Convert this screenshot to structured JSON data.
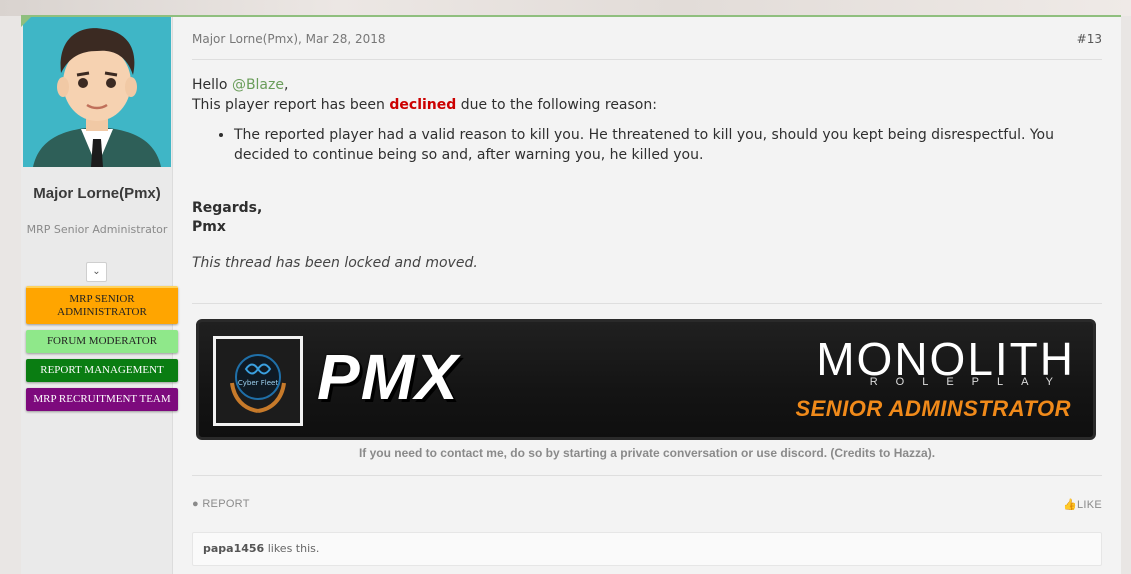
{
  "user": {
    "name": "Major Lorne(Pmx)",
    "title": "MRP Senior Administrator",
    "badges": [
      "MRP SENIOR ADMINISTRATOR",
      "FORUM MODERATOR",
      "REPORT MANAGEMENT",
      "MRP RECRUITMENT TEAM"
    ],
    "badge_colors": [
      "#ffa500",
      "#8fe88a",
      "#0a7d12",
      "#7d0a7d"
    ],
    "toggle_icon": "chevron-down-icon"
  },
  "post": {
    "author_date": "Major Lorne(Pmx), Mar 28, 2018",
    "number": "#13",
    "greeting": "Hello ",
    "mention": "@Blaze",
    "greeting_end": ",",
    "line1_a": "This player report has been ",
    "declined": "declined",
    "line1_b": " due to the following reason:",
    "reason": "The reported player had a valid reason to kill you. He threatened to kill you, should you kept being disrespectful. You decided to continue being so and, after warning you, he killed you.",
    "regards": "Regards,",
    "signoff": "Pmx",
    "locked_note": "This thread has been locked and moved."
  },
  "signature": {
    "banner_name": "PMX",
    "banner_brand": "MONOLITH",
    "banner_sub": "ROLEPLAY",
    "banner_role": "SENIOR ADMINSTRATOR",
    "logo_text": "Cyber Fleet",
    "text": "If you need to contact me, do so by starting a private conversation or use discord. (Credits to Hazza)."
  },
  "actions": {
    "report": "REPORT",
    "like": "LIKE"
  },
  "likes": {
    "user": "papa1456",
    "suffix": " likes this."
  },
  "colors": {
    "accent": "#8fbf7e",
    "mention": "#6a9d5a",
    "declined": "#cc0000",
    "banner_role": "#f08a1a"
  }
}
